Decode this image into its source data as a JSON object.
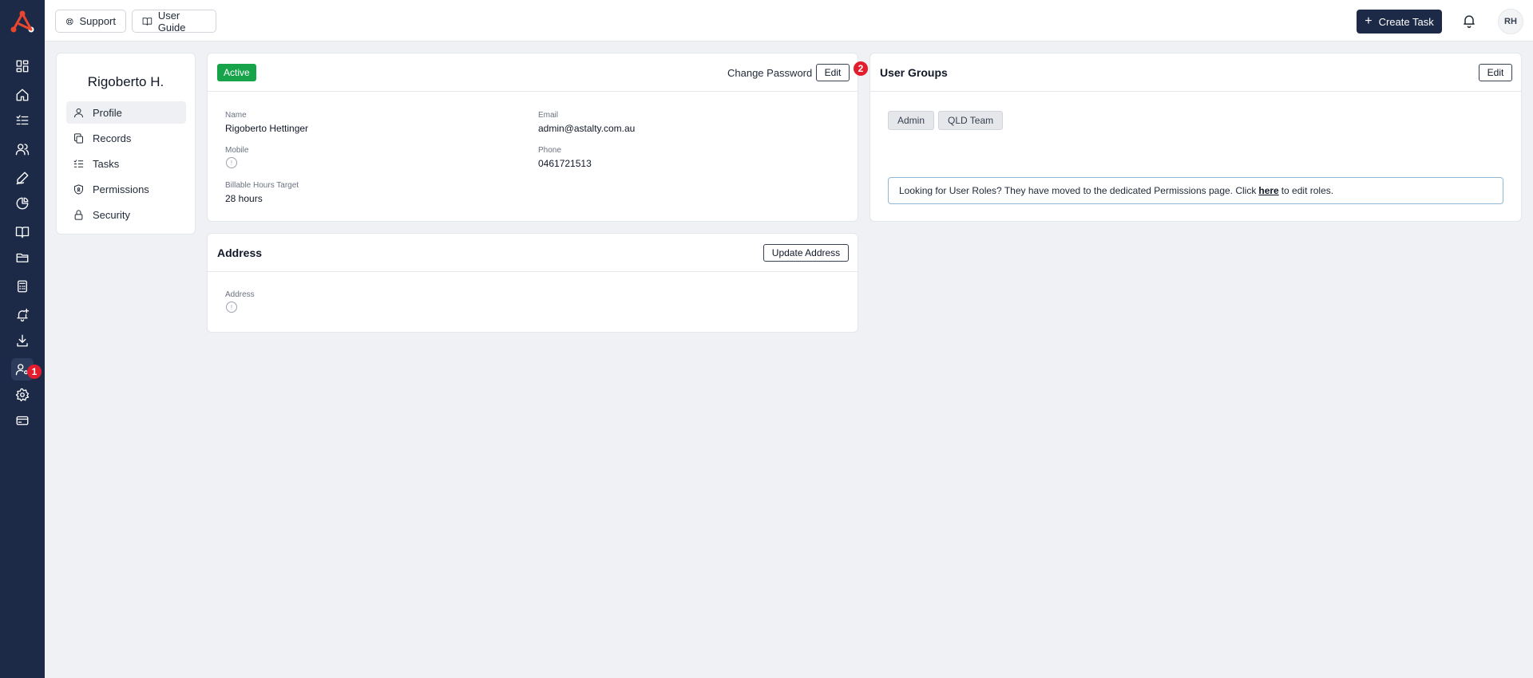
{
  "sidebar": {
    "items": [
      {
        "name": "dashboard-icon"
      },
      {
        "name": "home-icon"
      },
      {
        "name": "checklist-icon"
      },
      {
        "name": "users-icon"
      },
      {
        "name": "signature-icon"
      },
      {
        "name": "pie-chart-icon"
      },
      {
        "name": "book-icon"
      },
      {
        "name": "folder-icon"
      },
      {
        "name": "calculator-icon"
      },
      {
        "name": "bell-plus-icon"
      },
      {
        "name": "download-icon"
      },
      {
        "name": "user-settings-icon"
      },
      {
        "name": "gear-icon"
      },
      {
        "name": "credit-card-icon"
      }
    ],
    "badge": "1"
  },
  "header": {
    "support": "Support",
    "user_guide": "User Guide",
    "create_task": "Create Task",
    "avatar": "RH"
  },
  "profile": {
    "name": "Rigoberto H.",
    "menu": [
      "Profile",
      "Records",
      "Tasks",
      "Permissions",
      "Security"
    ]
  },
  "details": {
    "status": "Active",
    "change_password": "Change Password",
    "edit": "Edit",
    "badge": "2",
    "fields": {
      "name_label": "Name",
      "name_value": "Rigoberto Hettinger",
      "email_label": "Email",
      "email_value": "admin@astalty.com.au",
      "mobile_label": "Mobile",
      "phone_label": "Phone",
      "phone_value": "0461721513",
      "billable_label": "Billable Hours Target",
      "billable_value": "28 hours"
    }
  },
  "address": {
    "title": "Address",
    "update": "Update Address",
    "label": "Address"
  },
  "groups": {
    "title": "User Groups",
    "edit": "Edit",
    "chips": [
      "Admin",
      "QLD Team"
    ],
    "notice_before": "Looking for User Roles? They have moved to the dedicated Permissions page. Click",
    "notice_link": "here",
    "notice_after": "to edit roles."
  }
}
